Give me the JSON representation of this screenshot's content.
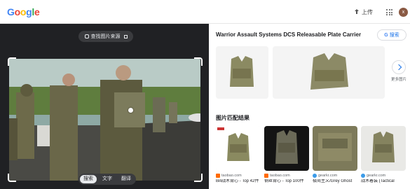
{
  "header": {
    "logo": [
      "G",
      "o",
      "o",
      "g",
      "l",
      "e"
    ],
    "logo_colors": [
      "#4285f4",
      "#ea4335",
      "#fbbc05",
      "#4285f4",
      "#34a853",
      "#ea4335"
    ],
    "upload_label": "上传",
    "avatar_letter": "x"
  },
  "left": {
    "source_pill": "查找图片来源",
    "modes": [
      "搜索",
      "文字",
      "翻译"
    ],
    "active_mode": "搜索"
  },
  "right": {
    "result_title": "Warrior Assault Systems DCS Releasable Plate Carrier",
    "search_button": "搜索",
    "more_label": "更多图片",
    "section_title": "图片匹配结果",
    "matches": [
      {
        "source": "taobao.com",
        "title": "Bill战术背心 - Top 42件"
      },
      {
        "source": "taobao.com",
        "title": "钢丝背心 - Top 100件"
      },
      {
        "source": "gearkr.com",
        "title": "极简主义/Grey Ghost"
      },
      {
        "source": "gearkr.com",
        "title": "战术着装 (Tactical"
      }
    ]
  },
  "colors": {
    "dark_bg": "#202124",
    "accent": "#1a73e8"
  }
}
